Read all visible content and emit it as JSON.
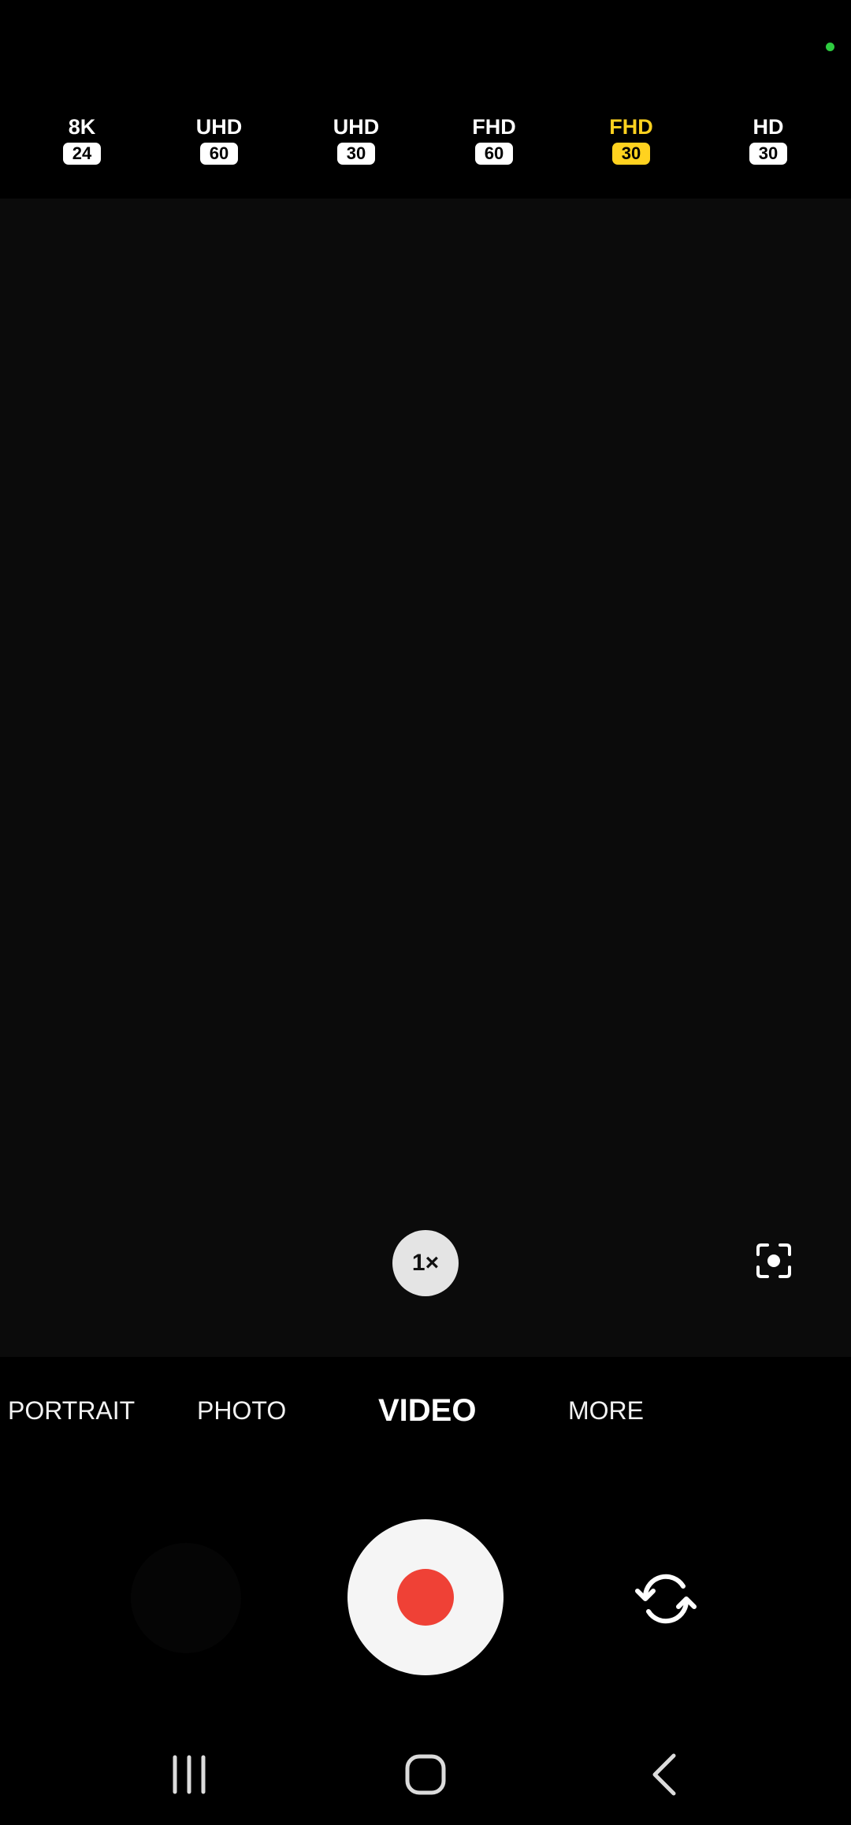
{
  "status": {
    "indicator_color": "#2ecc40",
    "indicator_icon": "camera-in-use-dot-icon"
  },
  "resolutions": [
    {
      "label": "8K",
      "fps": "24",
      "selected": false
    },
    {
      "label": "UHD",
      "fps": "60",
      "selected": false
    },
    {
      "label": "UHD",
      "fps": "30",
      "selected": false
    },
    {
      "label": "FHD",
      "fps": "60",
      "selected": false
    },
    {
      "label": "FHD",
      "fps": "30",
      "selected": true
    },
    {
      "label": "HD",
      "fps": "30",
      "selected": false
    }
  ],
  "colors": {
    "accent": "#ffd21f",
    "record": "#ef4136",
    "background": "#000000"
  },
  "zoom": {
    "label": "1×"
  },
  "focus": {
    "icon": "focus-frame-icon"
  },
  "modes": [
    {
      "label": "PORTRAIT",
      "active": false
    },
    {
      "label": "PHOTO",
      "active": false
    },
    {
      "label": "VIDEO",
      "active": true
    },
    {
      "label": "MORE",
      "active": false
    }
  ],
  "controls": {
    "gallery_icon": "gallery-thumbnail",
    "shutter_icon": "record-icon",
    "switch_icon": "switch-camera-icon"
  },
  "navigation": {
    "recents_icon": "recents-icon",
    "home_icon": "home-icon",
    "back_icon": "back-icon"
  }
}
